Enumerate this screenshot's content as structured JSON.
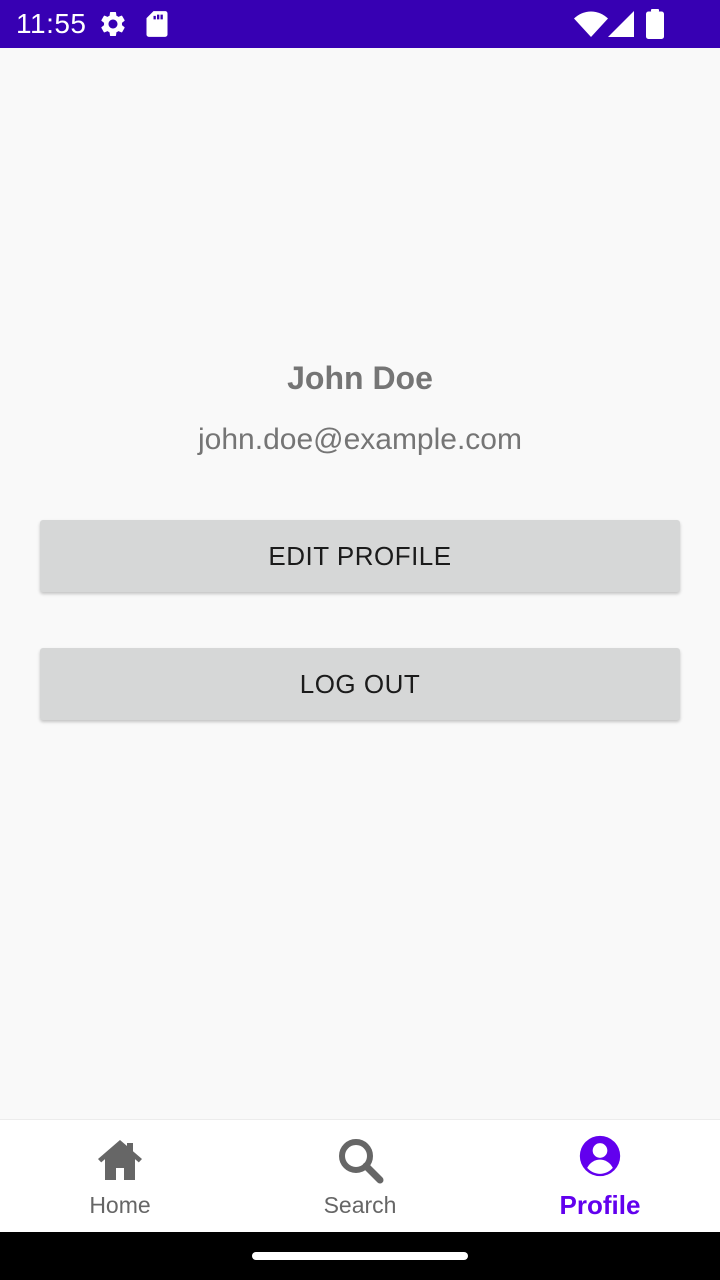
{
  "status_bar": {
    "time": "11:55",
    "background_color": "#3700b3",
    "icons": [
      "settings-gear-icon",
      "sd-card-icon",
      "wifi-icon",
      "signal-icon",
      "battery-icon"
    ]
  },
  "profile": {
    "name": "John Doe",
    "email": "john.doe@example.com"
  },
  "actions": {
    "edit_profile_label": "EDIT PROFILE",
    "log_out_label": "LOG OUT"
  },
  "bottom_nav": {
    "active_tab": "Profile",
    "active_color": "#6200ee",
    "inactive_color": "#666666",
    "items": [
      {
        "label": "Home",
        "icon": "home-icon"
      },
      {
        "label": "Search",
        "icon": "search-icon"
      },
      {
        "label": "Profile",
        "icon": "account-circle-icon"
      }
    ]
  }
}
